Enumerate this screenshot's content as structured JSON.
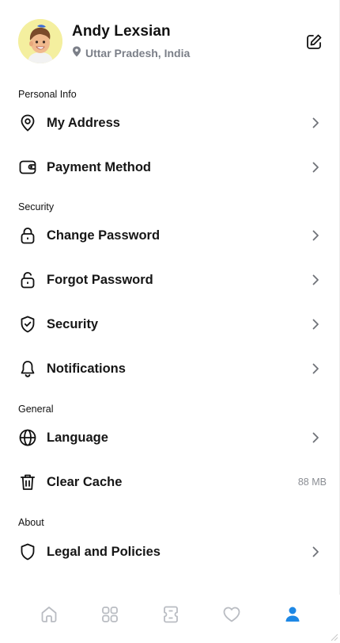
{
  "profile": {
    "name": "Andy Lexsian",
    "location": "Uttar Pradesh, India"
  },
  "sections": [
    {
      "title": "Personal Info"
    },
    {
      "title": "Security"
    },
    {
      "title": "General"
    },
    {
      "title": "About"
    }
  ],
  "items": {
    "my_address": {
      "label": "My Address",
      "icon": "location-pin-icon"
    },
    "payment_method": {
      "label": "Payment Method",
      "icon": "wallet-icon"
    },
    "change_password": {
      "label": "Change Password",
      "icon": "lock-icon"
    },
    "forgot_password": {
      "label": "Forgot Password",
      "icon": "unlock-icon"
    },
    "security": {
      "label": "Security",
      "icon": "shield-check-icon"
    },
    "notifications": {
      "label": "Notifications",
      "icon": "bell-icon"
    },
    "language": {
      "label": "Language",
      "icon": "globe-icon"
    },
    "clear_cache": {
      "label": "Clear Cache",
      "icon": "trash-icon",
      "value": "88 MB"
    },
    "legal": {
      "label": "Legal and Policies",
      "icon": "shield-icon"
    }
  },
  "tabbar": {
    "tabs": [
      {
        "name": "home",
        "icon": "home-icon",
        "active": false
      },
      {
        "name": "categories",
        "icon": "grid-icon",
        "active": false
      },
      {
        "name": "tickets",
        "icon": "ticket-icon",
        "active": false
      },
      {
        "name": "favorites",
        "icon": "heart-icon",
        "active": false
      },
      {
        "name": "profile",
        "icon": "user-icon",
        "active": true
      }
    ],
    "active_color": "#1e88e5",
    "inactive_color": "#b9bcc2"
  }
}
